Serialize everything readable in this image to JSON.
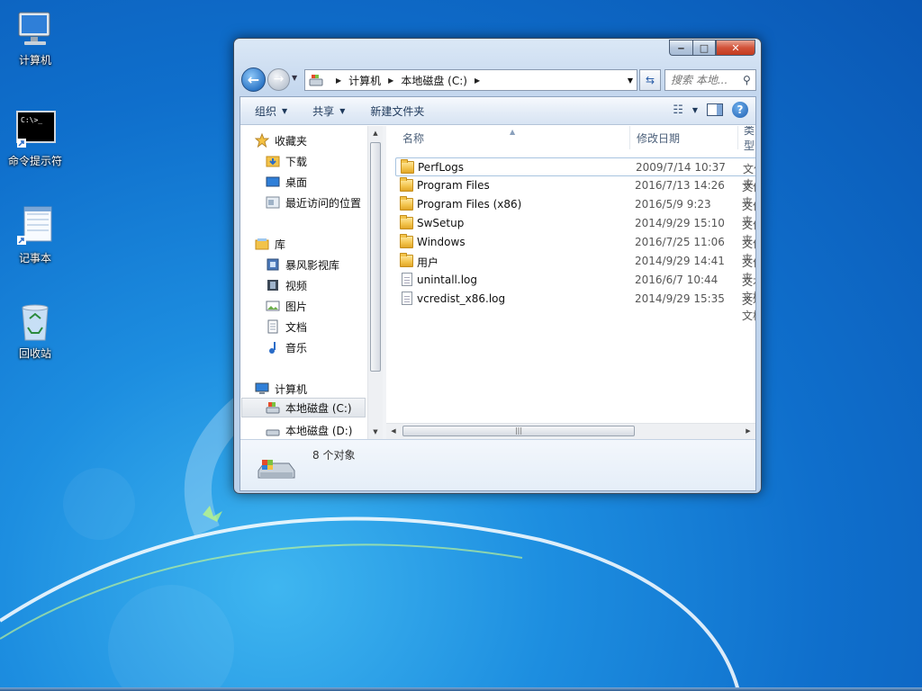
{
  "desktop": {
    "icons": [
      {
        "label": "计算机",
        "icon": "computer-icon"
      },
      {
        "label": "命令提示符",
        "icon": "cmd-icon"
      },
      {
        "label": "记事本",
        "icon": "notepad-icon"
      },
      {
        "label": "回收站",
        "icon": "recycle-bin-icon"
      }
    ],
    "cmd_text": "C:\\>_"
  },
  "window": {
    "caption": {
      "minimize": "‒",
      "maximize": "□",
      "close": "✕"
    },
    "address": {
      "segments": [
        "计算机",
        "本地磁盘 (C:)"
      ]
    },
    "search": {
      "placeholder": "搜索 本地..."
    },
    "toolbar": {
      "organize": "组织",
      "share": "共享",
      "new_folder": "新建文件夹"
    },
    "nav": {
      "favorites": "收藏夹",
      "downloads": "下载",
      "desktop": "桌面",
      "recent": "最近访问的位置",
      "libraries": "库",
      "storm": "暴风影视库",
      "videos": "视频",
      "pictures": "图片",
      "documents": "文档",
      "music": "音乐",
      "computer": "计算机",
      "drive_c": "本地磁盘 (C:)",
      "drive_d": "本地磁盘 (D:)"
    },
    "columns": {
      "name": "名称",
      "modified": "修改日期",
      "type": "类型"
    },
    "files": [
      {
        "name": "PerfLogs",
        "date": "2009/7/14 10:37",
        "type": "文件夹",
        "kind": "folder"
      },
      {
        "name": "Program Files",
        "date": "2016/7/13 14:26",
        "type": "文件夹",
        "kind": "folder"
      },
      {
        "name": "Program Files (x86)",
        "date": "2016/5/9 9:23",
        "type": "文件夹",
        "kind": "folder"
      },
      {
        "name": "SwSetup",
        "date": "2014/9/29 15:10",
        "type": "文件夹",
        "kind": "folder"
      },
      {
        "name": "Windows",
        "date": "2016/7/25 11:06",
        "type": "文件夹",
        "kind": "folder"
      },
      {
        "name": "用户",
        "date": "2014/9/29 14:41",
        "type": "文件夹",
        "kind": "folder"
      },
      {
        "name": "unintall.log",
        "date": "2016/6/7 10:44",
        "type": "文本文档",
        "kind": "file"
      },
      {
        "name": "vcredist_x86.log",
        "date": "2014/9/29 15:35",
        "type": "文本文档",
        "kind": "file"
      }
    ],
    "status": {
      "count": "8 个对象"
    }
  }
}
